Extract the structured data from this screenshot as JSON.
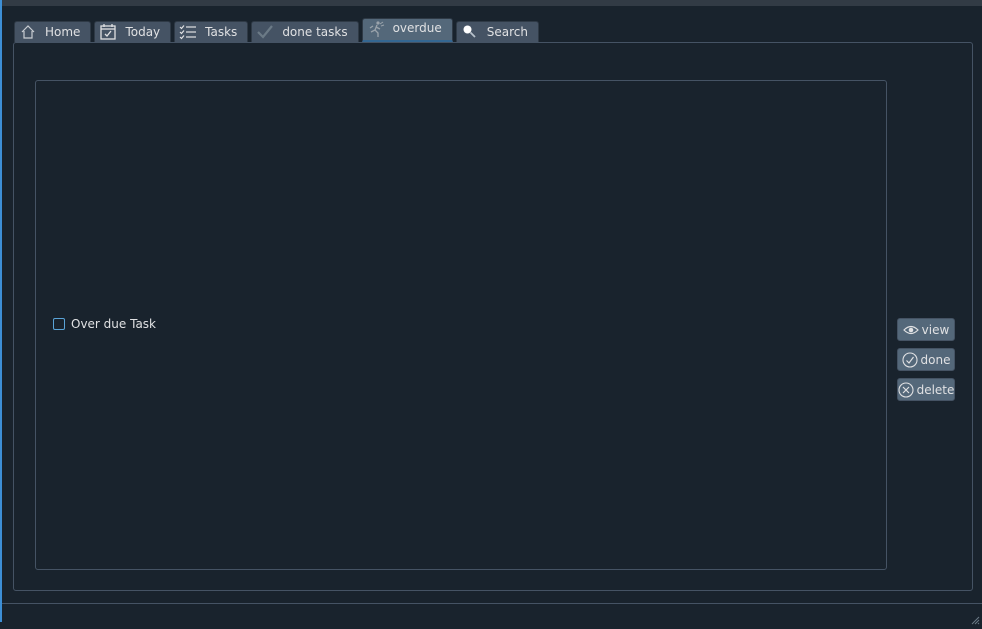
{
  "tabs": [
    {
      "label": "Home",
      "icon": "home-icon"
    },
    {
      "label": "Today",
      "icon": "calendar-check-icon"
    },
    {
      "label": "Tasks",
      "icon": "checklist-icon"
    },
    {
      "label": "done tasks",
      "icon": "checkmark-icon"
    },
    {
      "label": "overdue",
      "icon": "overdue-icon",
      "active": true
    },
    {
      "label": "Search",
      "icon": "search-icon"
    }
  ],
  "tasks": [
    {
      "label": "Over due Task",
      "checked": false
    }
  ],
  "actions": {
    "view_label": "view",
    "done_label": "done",
    "delete_label": "delete"
  },
  "colors": {
    "background": "#19232d",
    "button": "#54687a",
    "border": "#455364",
    "accent": "#346792"
  }
}
